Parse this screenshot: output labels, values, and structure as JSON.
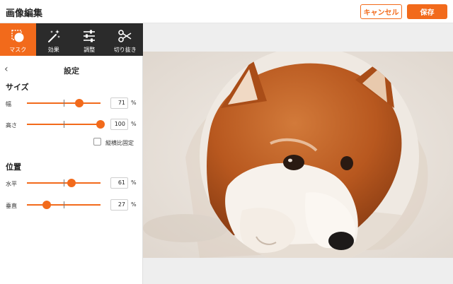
{
  "header": {
    "title": "画像編集",
    "cancel_label": "キャンセル",
    "save_label": "保存"
  },
  "toolbar": {
    "items": [
      {
        "label": "マスク",
        "icon": "mask-icon",
        "active": true
      },
      {
        "label": "効果",
        "icon": "magic-wand-icon",
        "active": false
      },
      {
        "label": "調整",
        "icon": "sliders-icon",
        "active": false
      },
      {
        "label": "切り抜き",
        "icon": "scissors-icon",
        "active": false
      }
    ]
  },
  "settings": {
    "title": "設定",
    "size": {
      "title": "サイズ",
      "width": {
        "label": "幅",
        "value": "71",
        "unit": "%",
        "level": 0.71
      },
      "height": {
        "label": "高さ",
        "value": "100",
        "unit": "%",
        "level": 1.0
      },
      "lock_ratio_label": "縦横比固定",
      "lock_ratio_checked": false
    },
    "position": {
      "title": "位置",
      "horizontal": {
        "label": "水平",
        "value": "61",
        "unit": "%",
        "level": 0.61
      },
      "vertical": {
        "label": "垂直",
        "value": "27",
        "unit": "%",
        "level": 0.27
      }
    }
  },
  "colors": {
    "accent": "#f26a1b",
    "toolbar_bg": "#2b2b2b",
    "canvas_bg": "#eeeeee"
  }
}
